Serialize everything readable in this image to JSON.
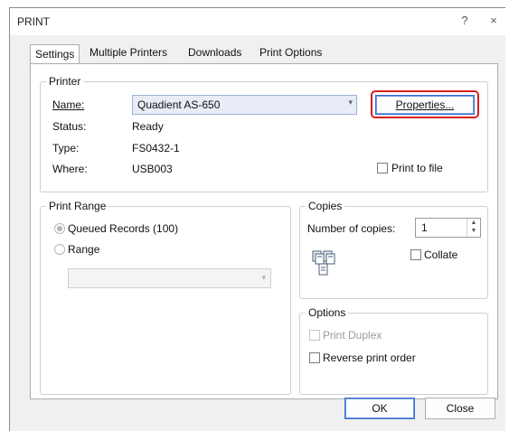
{
  "window": {
    "title": "PRINT",
    "help_glyph": "?",
    "close_glyph": "×"
  },
  "tabs": [
    {
      "label": "Settings",
      "active": true
    },
    {
      "label": "Multiple Printers",
      "active": false
    },
    {
      "label": "Downloads",
      "active": false
    },
    {
      "label": "Print Options",
      "active": false
    }
  ],
  "printer": {
    "legend": "Printer",
    "name_label": "Name:",
    "name_value": "Quadient AS-650",
    "status_label": "Status:",
    "status_value": "Ready",
    "type_label": "Type:",
    "type_value": "FS0432-1",
    "where_label": "Where:",
    "where_value": "USB003",
    "properties_button": "Properties...",
    "print_to_file_label": "Print to file",
    "print_to_file_checked": false
  },
  "print_range": {
    "legend": "Print Range",
    "queued_label": "Queued Records (100)",
    "queued_selected": true,
    "range_label": "Range",
    "range_selected": false
  },
  "copies": {
    "legend": "Copies",
    "number_label": "Number of copies:",
    "number_value": "1",
    "collate_label": "Collate",
    "collate_checked": false
  },
  "options": {
    "legend": "Options",
    "duplex_label": "Print Duplex",
    "duplex_enabled": false,
    "reverse_label": "Reverse print order",
    "reverse_checked": false
  },
  "footer": {
    "ok_label": "OK",
    "close_label": "Close"
  },
  "colors": {
    "highlight": "#d91e1e",
    "combo_bg": "#e7ecf7"
  }
}
